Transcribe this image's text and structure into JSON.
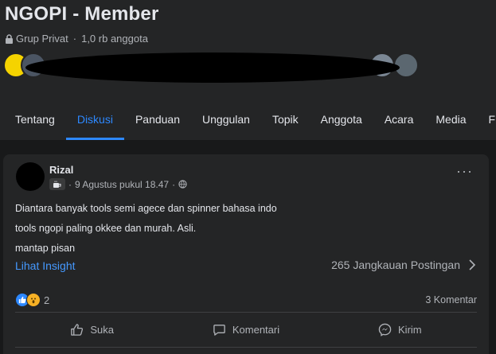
{
  "group": {
    "title": "NGOPI - Member",
    "privacy": "Grup Privat",
    "separator": "·",
    "member_count": "1,0 rb anggota"
  },
  "tabs": [
    {
      "label": "Tentang"
    },
    {
      "label": "Diskusi"
    },
    {
      "label": "Panduan"
    },
    {
      "label": "Unggulan"
    },
    {
      "label": "Topik"
    },
    {
      "label": "Anggota"
    },
    {
      "label": "Acara"
    },
    {
      "label": "Media"
    },
    {
      "label": "File"
    }
  ],
  "active_tab": "Diskusi",
  "post": {
    "author": "Rizal",
    "timestamp": "9 Agustus pukul 18.47",
    "separator": "·",
    "more_label": "···",
    "body": [
      "Diantara banyak tools semi agece dan  spinner bahasa indo",
      "tools ngopi paling okkee dan murah. Asli.",
      "mantap pisan"
    ],
    "insight_label": "Lihat Insight",
    "reach_label": "265 Jangkauan Postingan",
    "reaction_count": "2",
    "comment_count": "3 Komentar",
    "actions": {
      "like": "Suka",
      "comment": "Komentari",
      "send": "Kirim"
    }
  },
  "icons": {
    "privacy": "lock-icon",
    "badge": "coffee-cup-icon",
    "audience": "globe-icon",
    "reach": "chevron-right-icon",
    "like": "thumbs-up-icon",
    "comment": "speech-bubble-icon",
    "send": "messenger-icon"
  },
  "colors": {
    "accent": "#2d88ff",
    "link": "#4599ff",
    "background": "#18191a",
    "card": "#242526"
  }
}
